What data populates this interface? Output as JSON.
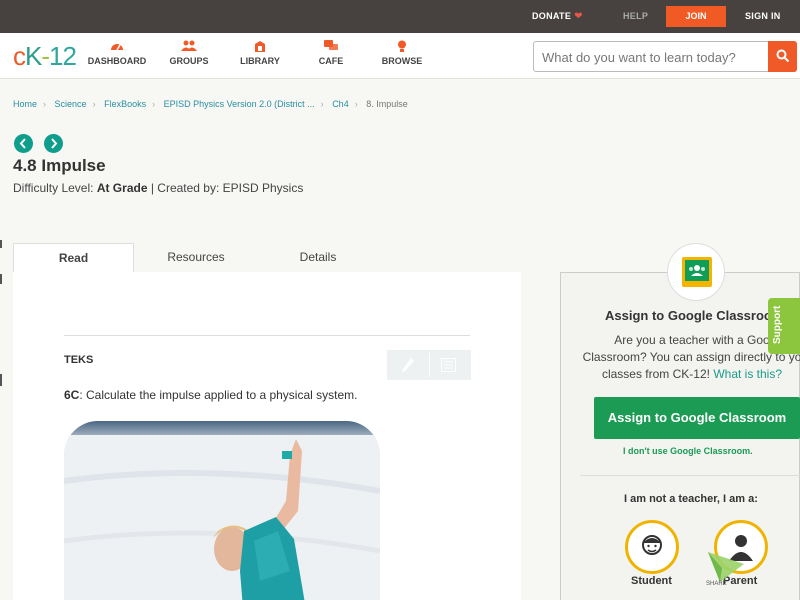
{
  "topbar": {
    "donate": "DONATE",
    "help": "HELP",
    "join": "JOIN",
    "signin": "SIGN IN"
  },
  "nav": {
    "logo": {
      "c": "c",
      "k": "K",
      "dash": "-",
      "n": "12"
    },
    "items": [
      {
        "label": "DASHBOARD",
        "icon": "dashboard-icon"
      },
      {
        "label": "GROUPS",
        "icon": "groups-icon"
      },
      {
        "label": "LIBRARY",
        "icon": "library-icon"
      },
      {
        "label": "CAFE",
        "icon": "cafe-icon"
      },
      {
        "label": "BROWSE",
        "icon": "browse-icon"
      }
    ],
    "search_placeholder": "What do you want to learn today?"
  },
  "breadcrumb": [
    "Home",
    "Science",
    "FlexBooks",
    "EPISD Physics Version 2.0 (District ...",
    "Ch4",
    "8. Impulse"
  ],
  "page": {
    "title": "4.8 Impulse",
    "difficulty_prefix": "Difficulty Level: ",
    "difficulty": "At Grade",
    "created_by": " | Created by: EPISD Physics"
  },
  "tabs": [
    "Read",
    "Resources",
    "Details"
  ],
  "content": {
    "teks_heading": "TEKS",
    "standard_code": "6C",
    "standard_text": ":  Calculate the impulse applied to a physical system."
  },
  "sidebar": {
    "heading": "Assign to Google Classroo",
    "line1": "Are you a teacher with a Goo",
    "line2": "Classroom? You can assign directly to yo",
    "line3": "classes from CK-12! ",
    "what_link": "What is this?",
    "assign_button": "Assign to Google Classroom",
    "dont_use": "I don't use Google Classroom.",
    "not_teacher": "I am not a teacher, I am a:",
    "student": "Student",
    "parent": "Parent",
    "share": "SHARE"
  },
  "support": "Support",
  "colors": {
    "accent": "#f05a28",
    "teal": "#0f9d8c",
    "google_green": "#1b9b54",
    "support_green": "#8cc63f"
  }
}
